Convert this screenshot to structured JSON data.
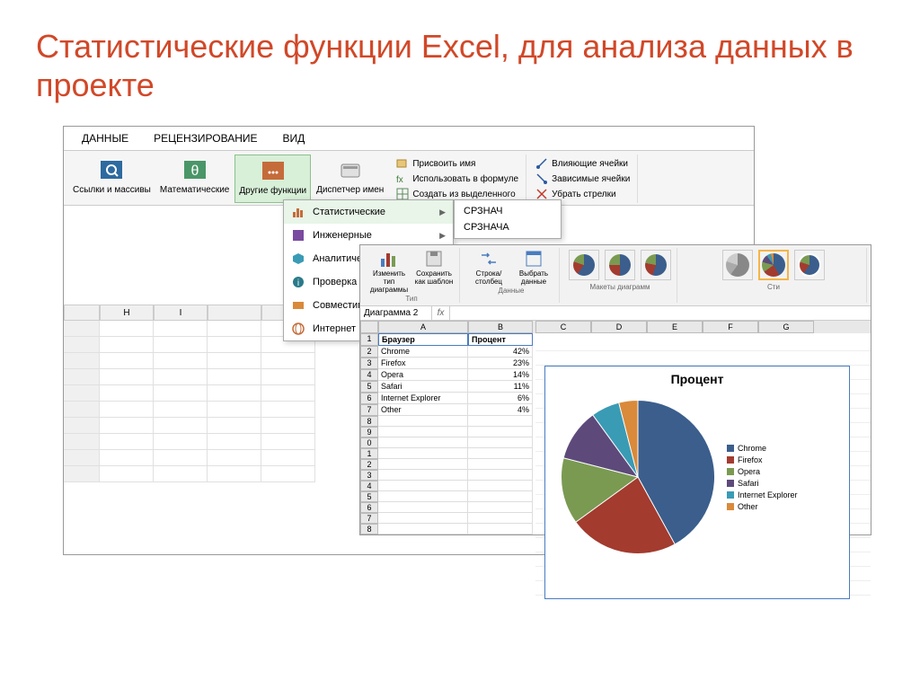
{
  "slide": {
    "title": "Статистические функции Excel, для анализа данных в проекте"
  },
  "ribbon_tabs": [
    "ДАННЫЕ",
    "РЕЦЕНЗИРОВАНИЕ",
    "ВИД"
  ],
  "ribbon": {
    "links": "Ссылки и массивы",
    "math": "Математические",
    "other_fn": "Другие функции",
    "name_mgr": "Диспетчер имен",
    "assign_name": "Присвоить имя",
    "use_in_formula": "Использовать в формуле",
    "create_from_sel": "Создать из выделенного",
    "trace_prec": "Влияющие ячейки",
    "trace_dep": "Зависимые ячейки",
    "remove_arrows": "Убрать стрелки"
  },
  "dropdown": {
    "statistical": "Статистические",
    "engineering": "Инженерные",
    "analytical": "Аналитические",
    "check_props": "Проверка свойств и",
    "compatibility": "Совместимость",
    "internet": "Интернет"
  },
  "submenu": {
    "avg": "СРЗНАЧ",
    "avga": "СРЗНАЧА"
  },
  "sheet_cols": [
    "H",
    "I"
  ],
  "chart_window": {
    "ribbon": {
      "change_type": "Изменить тип диаграммы",
      "save_template": "Сохранить как шаблон",
      "type_label": "Тип",
      "row_col": "Строка/столбец",
      "select_data": "Выбрать данные",
      "data_label": "Данные",
      "layouts_label": "Макеты диаграмм",
      "styles_label": "Сти"
    },
    "name_box": "Диаграмма 2",
    "columns": [
      "A",
      "B",
      "C",
      "D",
      "E",
      "F",
      "G"
    ],
    "data_headers": {
      "browser": "Браузер",
      "percent": "Процент"
    },
    "data": [
      {
        "name": "Chrome",
        "pct": "42%"
      },
      {
        "name": "Firefox",
        "pct": "23%"
      },
      {
        "name": "Opera",
        "pct": "14%"
      },
      {
        "name": "Safari",
        "pct": "11%"
      },
      {
        "name": "Internet Explorer",
        "pct": "6%"
      },
      {
        "name": "Other",
        "pct": "4%"
      }
    ],
    "chart_title": "Процент"
  },
  "chart_data": {
    "type": "pie",
    "title": "Процент",
    "categories": [
      "Chrome",
      "Firefox",
      "Opera",
      "Safari",
      "Internet Explorer",
      "Other"
    ],
    "values": [
      42,
      23,
      14,
      11,
      6,
      4
    ],
    "colors": [
      "#3b5e8c",
      "#a33b2f",
      "#7a9a52",
      "#5d4a7a",
      "#3a9bb5",
      "#d98a3a"
    ]
  }
}
